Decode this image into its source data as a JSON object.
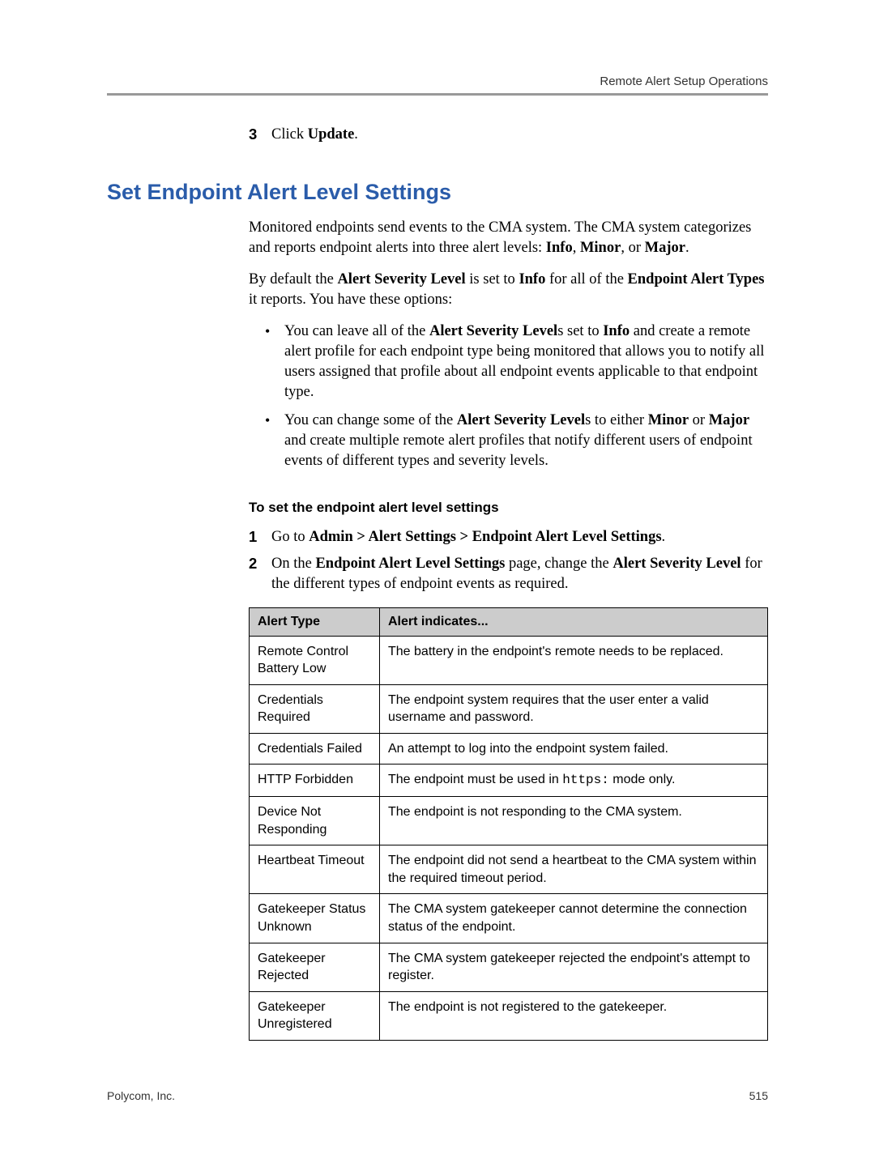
{
  "header": {
    "right": "Remote Alert Setup Operations"
  },
  "step3": {
    "num": "3",
    "pre": "Click ",
    "bold": "Update",
    "post": "."
  },
  "sectionTitle": "Set Endpoint Alert Level Settings",
  "intro": {
    "p1_a": "Monitored endpoints send events to the CMA system. The CMA system categorizes and reports endpoint alerts into three alert levels: ",
    "p1_b1": "Info",
    "p1_c1": ", ",
    "p1_b2": "Minor",
    "p1_c2": ", or ",
    "p1_b3": "Major",
    "p1_c3": ".",
    "p2_a": "By default the ",
    "p2_b1": "Alert Severity Level",
    "p2_c1": " is set to ",
    "p2_b2": "Info",
    "p2_c2": " for all of the ",
    "p2_b3": "Endpoint Alert Types",
    "p2_c3": " it reports. You have these options:"
  },
  "bullets": {
    "b1_a": "You can leave all of the ",
    "b1_b1": "Alert Severity Level",
    "b1_c1": "s set to ",
    "b1_b2": "Info",
    "b1_c2": " and create a remote alert profile for each endpoint type being monitored that allows you to notify all users assigned that profile about all endpoint events applicable to that endpoint type.",
    "b2_a": "You can change some of the ",
    "b2_b1": "Alert Severity Level",
    "b2_c1": "s to either ",
    "b2_b2": "Minor",
    "b2_c2": " or ",
    "b2_b3": "Major",
    "b2_c3": " and create multiple remote alert profiles that notify different users of endpoint events of different types and severity levels."
  },
  "subhead": "To set the endpoint alert level settings",
  "steps": {
    "s1": {
      "num": "1",
      "a": "Go to ",
      "b": "Admin > Alert Settings > Endpoint Alert Level Settings",
      "c": "."
    },
    "s2": {
      "num": "2",
      "a": "On the ",
      "b1": "Endpoint Alert Level Settings",
      "c1": " page, change the ",
      "b2": "Alert Severity Level",
      "c2": " for the different types of endpoint events as required."
    }
  },
  "table": {
    "headers": {
      "type": "Alert Type",
      "desc": "Alert indicates..."
    },
    "rows": [
      {
        "type": "Remote Control Battery Low",
        "desc": "The battery in the endpoint's remote needs to be replaced."
      },
      {
        "type": "Credentials Required",
        "desc": "The endpoint system requires that the user enter a valid username and password."
      },
      {
        "type": "Credentials Failed",
        "desc": "An attempt to log into the endpoint system failed."
      },
      {
        "type": "HTTP Forbidden",
        "desc_a": "The endpoint must be used in ",
        "desc_mono": "https:",
        "desc_b": " mode only."
      },
      {
        "type": "Device Not Responding",
        "desc": "The endpoint is not responding to the CMA system."
      },
      {
        "type": "Heartbeat Timeout",
        "desc": "The endpoint did not send a heartbeat to the CMA system within the required timeout period."
      },
      {
        "type": "Gatekeeper Status Unknown",
        "desc": "The CMA system gatekeeper cannot determine the connection status of the endpoint."
      },
      {
        "type": "Gatekeeper Rejected",
        "desc": "The CMA system gatekeeper rejected the endpoint's attempt to register."
      },
      {
        "type": "Gatekeeper Unregistered",
        "desc": "The endpoint is not registered to the gatekeeper."
      }
    ]
  },
  "footer": {
    "left": "Polycom, Inc.",
    "right": "515"
  }
}
